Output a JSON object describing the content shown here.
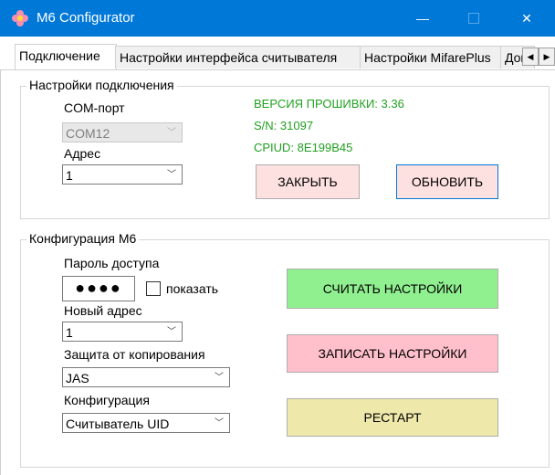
{
  "window": {
    "title": "M6 Configurator",
    "minimize": "—",
    "close": "✕"
  },
  "tabs": [
    {
      "label": "Подключение"
    },
    {
      "label": "Настройки интерфейса считывателя"
    },
    {
      "label": "Настройки MifarePlus"
    },
    {
      "label": "Дополнительно"
    }
  ],
  "tab_scroll": {
    "left": "◀",
    "right": "▶"
  },
  "connection": {
    "legend": "Настройки подключения",
    "com_label": "COM-порт",
    "com_value": "COM12",
    "address_label": "Адрес",
    "address_value": "1",
    "firmware": "ВЕРСИЯ ПРОШИВКИ: 3.36",
    "serial": "S/N: 31097",
    "cpuid": "CPIUD: 8E199B45",
    "close_button": "ЗАКРЫТЬ",
    "refresh_button": "ОБНОВИТЬ"
  },
  "config": {
    "legend": "Конфигурация M6",
    "password_label": "Пароль доступа",
    "password_value": "●●●●",
    "show_label": "показать",
    "new_address_label": "Новый адрес",
    "new_address_value": "1",
    "copy_protection_label": "Защита от копирования",
    "copy_protection_value": "JAS",
    "configuration_label": "Конфигурация",
    "configuration_value": "Считыватель UID",
    "read_button": "СЧИТАТЬ НАСТРОЙКИ",
    "write_button": "ЗАПИСАТЬ НАСТРОЙКИ",
    "restart_button": "РЕСТАРТ"
  },
  "colors": {
    "titlebar": "#0078d7",
    "status_green": "#20a020",
    "close_btn_bg": "#fde0e0",
    "read_btn_bg": "#90f090",
    "write_btn_bg": "#ffc0cb",
    "restart_btn_bg": "#eee8aa"
  }
}
